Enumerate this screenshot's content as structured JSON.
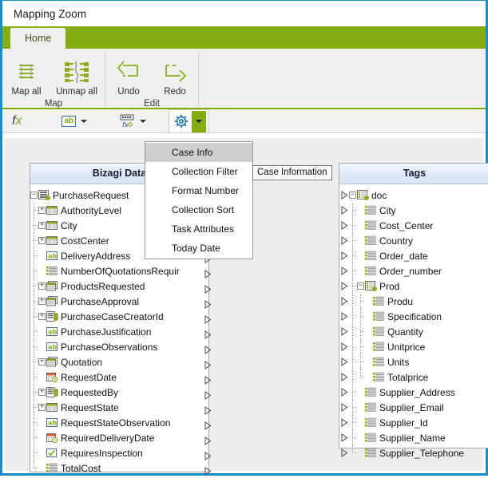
{
  "window": {
    "title": "Mapping Zoom",
    "border_color": "#1a8ccc"
  },
  "ribbon": {
    "accent_color": "#84ad12",
    "tabs": [
      {
        "label": "Home",
        "active": true
      }
    ],
    "groups": [
      {
        "label": "Map",
        "buttons": [
          {
            "label": "Map all",
            "icon": "map-all-icon"
          },
          {
            "label": "Unmap all",
            "icon": "unmap-all-icon"
          }
        ]
      },
      {
        "label": "Edit",
        "buttons": [
          {
            "label": "Undo",
            "icon": "undo-icon"
          },
          {
            "label": "Redo",
            "icon": "redo-icon"
          }
        ]
      }
    ]
  },
  "toolbar": {
    "fx_label": "fx",
    "items": [
      {
        "name": "function-button",
        "icon": "fx-icon"
      },
      {
        "name": "text-format-button",
        "icon": "ab-icon",
        "has_caret": true
      },
      {
        "name": "number-format-button",
        "icon": "number-format-icon",
        "has_caret": true
      },
      {
        "name": "settings-button",
        "icon": "gear-icon",
        "has_caret": true
      }
    ]
  },
  "menu": {
    "open": true,
    "items": [
      {
        "label": "Case Info",
        "selected": true
      },
      {
        "label": "Collection Filter",
        "selected": false
      },
      {
        "label": "Format Number",
        "selected": false
      },
      {
        "label": "Collection Sort",
        "selected": false
      },
      {
        "label": "Task Attributes",
        "selected": false
      },
      {
        "label": "Today Date",
        "selected": false
      }
    ]
  },
  "tooltip": {
    "text": "Case Information"
  },
  "left_panel": {
    "title": "Bizagi Data",
    "nodes": [
      {
        "label": "PurchaseRequest",
        "depth": 0,
        "expander": "minus",
        "icon": "entity-icon",
        "arrow": false,
        "last": false
      },
      {
        "label": "AuthorityLevel",
        "depth": 1,
        "expander": "plus",
        "icon": "table-icon",
        "arrow": false,
        "last": false
      },
      {
        "label": "City",
        "depth": 1,
        "expander": "plus",
        "icon": "table-icon",
        "arrow": false,
        "last": false
      },
      {
        "label": "CostCenter",
        "depth": 1,
        "expander": "plus",
        "icon": "table-icon",
        "arrow": false,
        "last": false
      },
      {
        "label": "DeliveryAddress",
        "depth": 1,
        "expander": "none",
        "icon": "text-icon",
        "arrow": true,
        "last": false
      },
      {
        "label": "NumberOfQuotationsRequir",
        "depth": 1,
        "expander": "none",
        "icon": "list-icon",
        "arrow": true,
        "last": false
      },
      {
        "label": "ProductsRequested",
        "depth": 1,
        "expander": "plus",
        "icon": "collection-icon",
        "arrow": true,
        "last": false
      },
      {
        "label": "PurchaseApproval",
        "depth": 1,
        "expander": "plus",
        "icon": "collection-icon",
        "arrow": true,
        "last": false
      },
      {
        "label": "PurchaseCaseCreatorId",
        "depth": 1,
        "expander": "plus",
        "icon": "user-icon",
        "arrow": true,
        "last": false
      },
      {
        "label": "PurchaseJustification",
        "depth": 1,
        "expander": "none",
        "icon": "text-icon",
        "arrow": true,
        "last": false
      },
      {
        "label": "PurchaseObservations",
        "depth": 1,
        "expander": "none",
        "icon": "text-icon",
        "arrow": true,
        "last": false
      },
      {
        "label": "Quotation",
        "depth": 1,
        "expander": "plus",
        "icon": "collection-icon",
        "arrow": true,
        "last": false
      },
      {
        "label": "RequestDate",
        "depth": 1,
        "expander": "none",
        "icon": "date-icon",
        "arrow": true,
        "last": false
      },
      {
        "label": "RequestedBy",
        "depth": 1,
        "expander": "plus",
        "icon": "user-icon",
        "arrow": true,
        "last": false
      },
      {
        "label": "RequestState",
        "depth": 1,
        "expander": "plus",
        "icon": "table-icon",
        "arrow": true,
        "last": false
      },
      {
        "label": "RequestStateObservation",
        "depth": 1,
        "expander": "none",
        "icon": "text-icon",
        "arrow": true,
        "last": false
      },
      {
        "label": "RequiredDeliveryDate",
        "depth": 1,
        "expander": "none",
        "icon": "date-icon",
        "arrow": true,
        "last": false
      },
      {
        "label": "RequiresInspection",
        "depth": 1,
        "expander": "none",
        "icon": "checkbox-icon",
        "arrow": true,
        "last": false
      },
      {
        "label": "TotalCost",
        "depth": 1,
        "expander": "none",
        "icon": "list-icon",
        "arrow": true,
        "last": true
      }
    ]
  },
  "right_panel": {
    "title": "Tags",
    "nodes": [
      {
        "label": "doc",
        "depth": 0,
        "expander": "minus",
        "icon": "tag-root-icon",
        "arrow": true,
        "last": false
      },
      {
        "label": "City",
        "depth": 1,
        "expander": "none",
        "icon": "tag-icon",
        "arrow": true,
        "last": false
      },
      {
        "label": "Cost_Center",
        "depth": 1,
        "expander": "none",
        "icon": "tag-icon",
        "arrow": true,
        "last": false
      },
      {
        "label": "Country",
        "depth": 1,
        "expander": "none",
        "icon": "tag-icon",
        "arrow": true,
        "last": false
      },
      {
        "label": "Order_date",
        "depth": 1,
        "expander": "none",
        "icon": "tag-icon",
        "arrow": true,
        "last": false
      },
      {
        "label": "Order_number",
        "depth": 1,
        "expander": "none",
        "icon": "tag-icon",
        "arrow": true,
        "last": false
      },
      {
        "label": "Prod",
        "depth": 1,
        "expander": "minus",
        "icon": "tag-root-icon",
        "arrow": true,
        "last": false
      },
      {
        "label": "Produ",
        "depth": 2,
        "expander": "none",
        "icon": "tag-icon",
        "arrow": true,
        "last": false
      },
      {
        "label": "Specification",
        "depth": 2,
        "expander": "none",
        "icon": "tag-icon",
        "arrow": true,
        "last": false
      },
      {
        "label": "Quantity",
        "depth": 2,
        "expander": "none",
        "icon": "tag-icon",
        "arrow": true,
        "last": false
      },
      {
        "label": "Unitprice",
        "depth": 2,
        "expander": "none",
        "icon": "tag-icon",
        "arrow": true,
        "last": false
      },
      {
        "label": "Units",
        "depth": 2,
        "expander": "none",
        "icon": "tag-icon",
        "arrow": true,
        "last": false
      },
      {
        "label": "Totalprice",
        "depth": 2,
        "expander": "none",
        "icon": "tag-icon",
        "arrow": true,
        "last": true
      },
      {
        "label": "Supplier_Address",
        "depth": 1,
        "expander": "none",
        "icon": "tag-icon",
        "arrow": true,
        "last": false
      },
      {
        "label": "Supplier_Email",
        "depth": 1,
        "expander": "none",
        "icon": "tag-icon",
        "arrow": true,
        "last": false
      },
      {
        "label": "Supplier_Id",
        "depth": 1,
        "expander": "none",
        "icon": "tag-icon",
        "arrow": true,
        "last": false
      },
      {
        "label": "Supplier_Name",
        "depth": 1,
        "expander": "none",
        "icon": "tag-icon",
        "arrow": true,
        "last": false
      },
      {
        "label": "Supplier_Telephone",
        "depth": 1,
        "expander": "none",
        "icon": "tag-icon",
        "arrow": true,
        "last": true
      }
    ]
  }
}
